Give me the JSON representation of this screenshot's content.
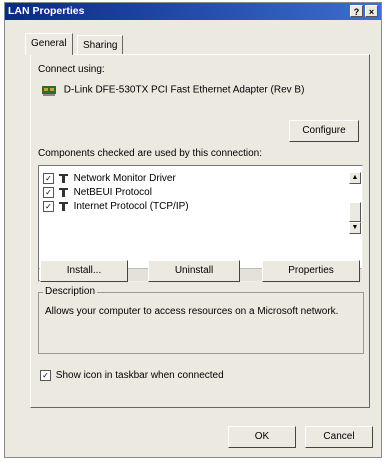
{
  "window": {
    "title": "LAN Properties",
    "help_glyph": "?",
    "close_glyph": "×"
  },
  "tabs": [
    {
      "label": "General"
    },
    {
      "label": "Sharing"
    }
  ],
  "connect_using": {
    "label": "Connect using:",
    "adapter": "D-Link DFE-530TX PCI Fast Ethernet Adapter (Rev B)",
    "configure_label": "Configure"
  },
  "components": {
    "label": "Components checked are used by this connection:",
    "items": [
      {
        "label": "Network Monitor Driver",
        "checked": true
      },
      {
        "label": "NetBEUI Protocol",
        "checked": true
      },
      {
        "label": "Internet Protocol (TCP/IP)",
        "checked": true
      }
    ]
  },
  "actions": {
    "install": "Install...",
    "uninstall": "Uninstall",
    "properties": "Properties"
  },
  "description": {
    "title": "Description",
    "text": "Allows your computer to access resources on a Microsoft network."
  },
  "taskbar": {
    "label": "Show icon in taskbar when connected",
    "checked": true
  },
  "footer": {
    "ok": "OK",
    "cancel": "Cancel"
  },
  "colors": {
    "titlebar_start": "#0a2a84",
    "titlebar_end": "#3d6ed0",
    "face": "#ece9e0"
  }
}
